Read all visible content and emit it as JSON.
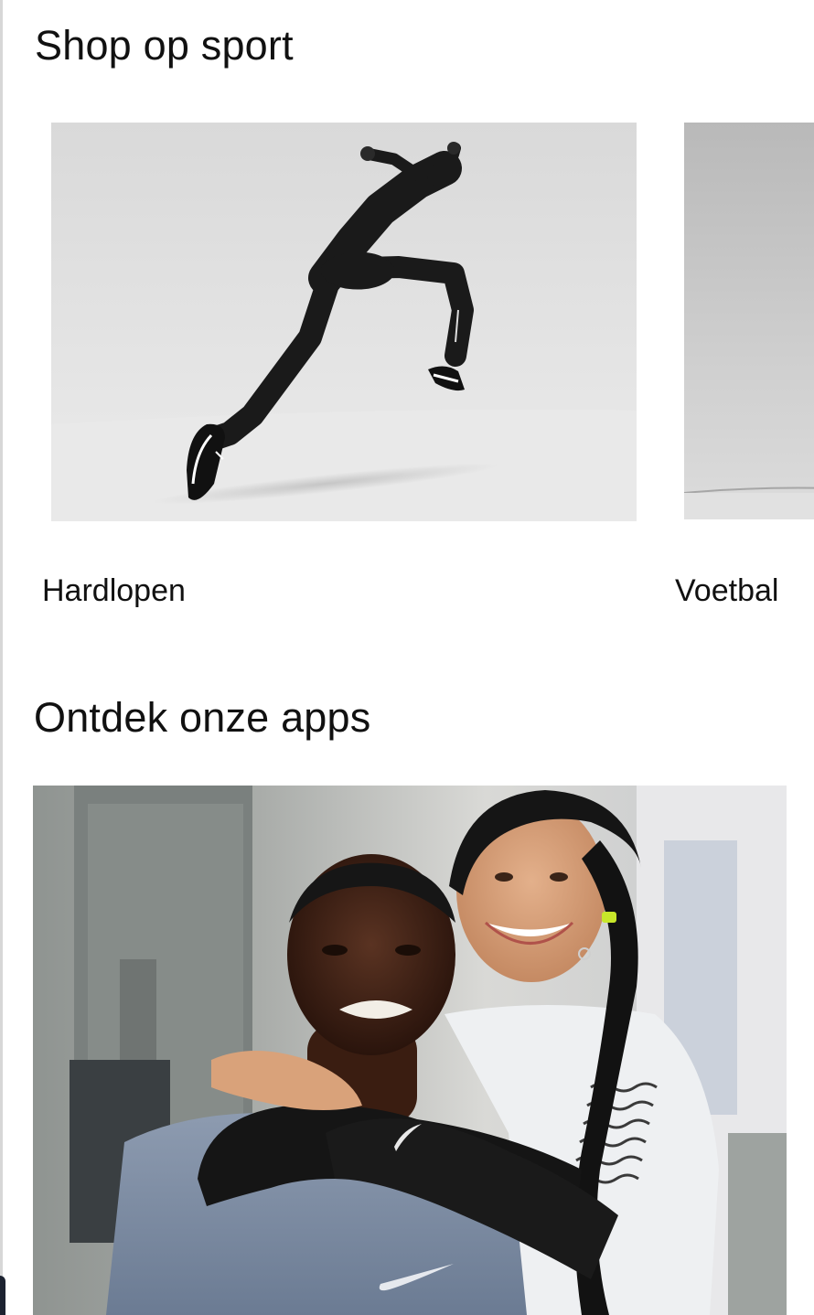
{
  "sections": {
    "sport": {
      "title": "Shop op sport",
      "cards": [
        {
          "label": "Hardlopen",
          "image": "sprinter-photo"
        },
        {
          "label": "Voetbal",
          "image": "football-photo"
        }
      ]
    },
    "apps": {
      "title": "Ontdek onze apps",
      "image": "couple-hugging-photo"
    }
  },
  "colors": {
    "text": "#111111",
    "background": "#ffffff",
    "photo_backdrop": "#e2e2e2"
  }
}
